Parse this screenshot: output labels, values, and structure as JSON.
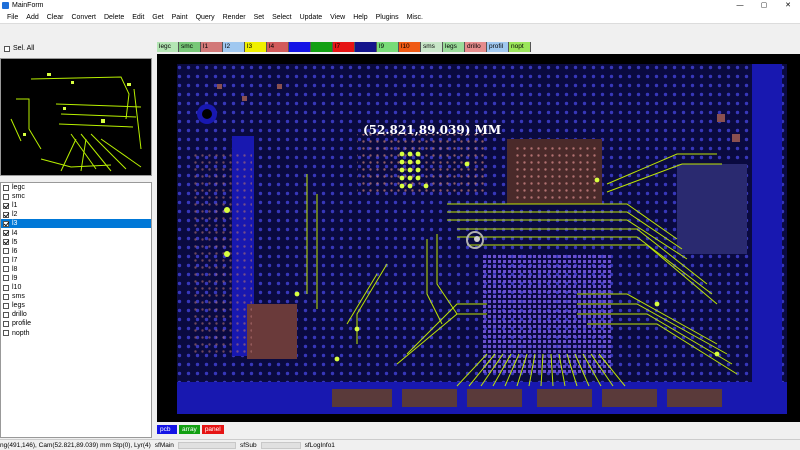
{
  "window": {
    "title": "MainForm",
    "controls": [
      "—",
      "▢",
      "✕"
    ]
  },
  "menu": [
    "File",
    "Add",
    "Clear",
    "Convert",
    "Delete",
    "Edit",
    "Get",
    "Paint",
    "Query",
    "Render",
    "Set",
    "Select",
    "Update",
    "View",
    "Help",
    "Plugins",
    "Misc."
  ],
  "sel_all": {
    "label": "Sel. All",
    "checked": false
  },
  "layers": [
    {
      "name": "legc",
      "checked": false
    },
    {
      "name": "smc",
      "checked": false
    },
    {
      "name": "l1",
      "checked": true
    },
    {
      "name": "l2",
      "checked": true
    },
    {
      "name": "l3",
      "checked": true,
      "selected": true
    },
    {
      "name": "l4",
      "checked": true
    },
    {
      "name": "l5",
      "checked": true
    },
    {
      "name": "l6",
      "checked": false
    },
    {
      "name": "l7",
      "checked": false
    },
    {
      "name": "l8",
      "checked": false
    },
    {
      "name": "l9",
      "checked": false
    },
    {
      "name": "l10",
      "checked": false
    },
    {
      "name": "sms",
      "checked": false
    },
    {
      "name": "legs",
      "checked": false
    },
    {
      "name": "drillo",
      "checked": false
    },
    {
      "name": "profile",
      "checked": false
    },
    {
      "name": "nopth",
      "checked": false
    }
  ],
  "layer_tabs": [
    {
      "label": "legc",
      "color": "#b4e6b4"
    },
    {
      "label": "smc",
      "color": "#78c878"
    },
    {
      "label": "l1",
      "color": "#d27878"
    },
    {
      "label": "l2",
      "color": "#a0c8f0"
    },
    {
      "label": "l3",
      "color": "#f0f000"
    },
    {
      "label": "l4",
      "color": "#d25a5a"
    },
    {
      "label": "",
      "color": "#1414e6"
    },
    {
      "label": "",
      "color": "#12a012"
    },
    {
      "label": "l7",
      "color": "#e61414"
    },
    {
      "label": "",
      "color": "#14148c"
    },
    {
      "label": "l9",
      "color": "#78dc78"
    },
    {
      "label": "l10",
      "color": "#f05a14"
    },
    {
      "label": "sms",
      "color": "#c8e6c8"
    },
    {
      "label": "legs",
      "color": "#9adc9a"
    },
    {
      "label": "drillo",
      "color": "#e68c8c"
    },
    {
      "label": "profil",
      "color": "#a0c8f0"
    },
    {
      "label": "nopt",
      "color": "#9be65a"
    }
  ],
  "canvas": {
    "coordinate_label": "(52.821,89.039) MM"
  },
  "bottom_tabs": [
    {
      "label": "pcb",
      "color": "#1414e6"
    },
    {
      "label": "array",
      "color": "#12a012"
    },
    {
      "label": "panel",
      "color": "#e61414"
    }
  ],
  "status": {
    "left": "ng(491,146), Cam(52.821,89.039) mm  Stp(0), Lyr(4)",
    "main": "sfMain",
    "sub": "sfSub",
    "log": "sfLogInfo1"
  }
}
